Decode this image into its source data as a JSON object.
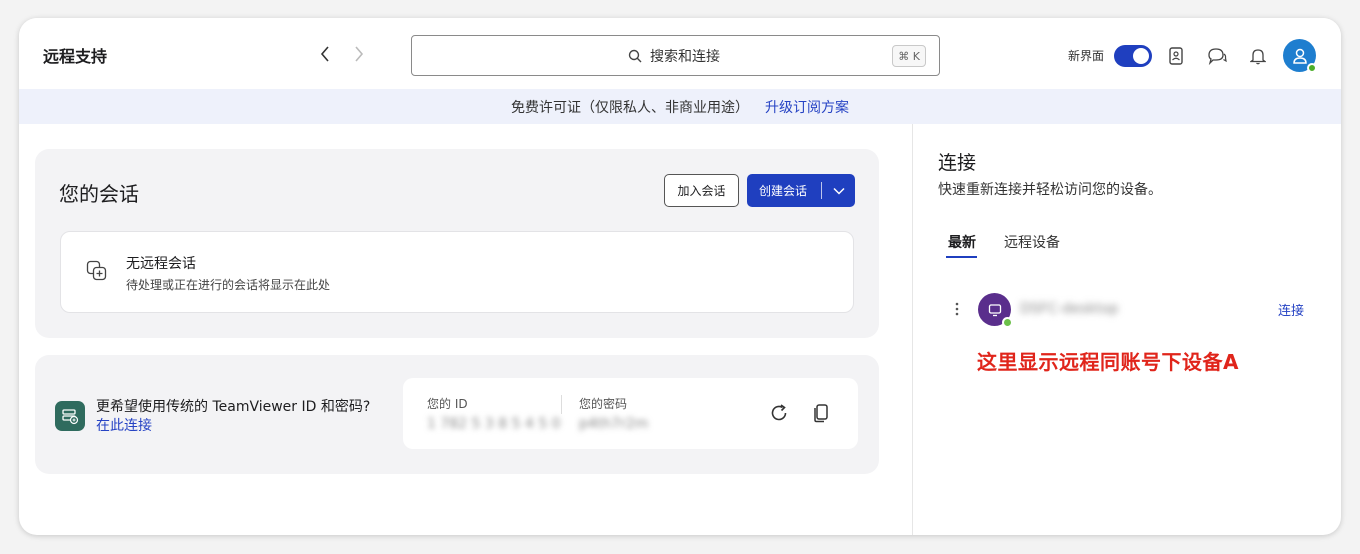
{
  "header": {
    "title": "远程支持",
    "search_placeholder": "搜索和连接",
    "search_shortcut": "⌘ K",
    "new_ui_label": "新界面",
    "new_ui_enabled": true,
    "icons": [
      "chevron-left-icon",
      "chevron-right-icon",
      "search-icon",
      "contact-card-icon",
      "chat-icon",
      "bell-icon",
      "user-icon"
    ]
  },
  "banner": {
    "text": "免费许可证（仅限私人、非商业用途）",
    "link": "升级订阅方案"
  },
  "sessions": {
    "title": "您的会话",
    "join_label": "加入会话",
    "create_label": "创建会话",
    "empty_title": "无远程会话",
    "empty_subtitle": "待处理或正在进行的会话将显示在此处"
  },
  "teamviewer_id": {
    "question": "更希望使用传统的 TeamViewer ID 和密码?",
    "link": "在此连接",
    "id_label": "您的 ID",
    "id_value": "1 782 5 3 8 5 4 5 0",
    "password_label": "您的密码",
    "password_value": "p4th7r2m"
  },
  "connect_panel": {
    "title": "连接",
    "subtitle": "快速重新连接并轻松访问您的设备。",
    "tabs": [
      {
        "label": "最新",
        "active": true
      },
      {
        "label": "远程设备",
        "active": false
      }
    ],
    "devices": [
      {
        "name": "DSFC-desktop",
        "action": "连接",
        "status": "online"
      }
    ],
    "annotation": "这里显示远程同账号下设备A"
  },
  "colors": {
    "accent": "#1f3fbf",
    "link": "#2643c4",
    "annotation": "#e0251b",
    "online": "#6cc04a",
    "device_avatar": "#5a2e8c",
    "tv_icon": "#2f6b5e"
  }
}
